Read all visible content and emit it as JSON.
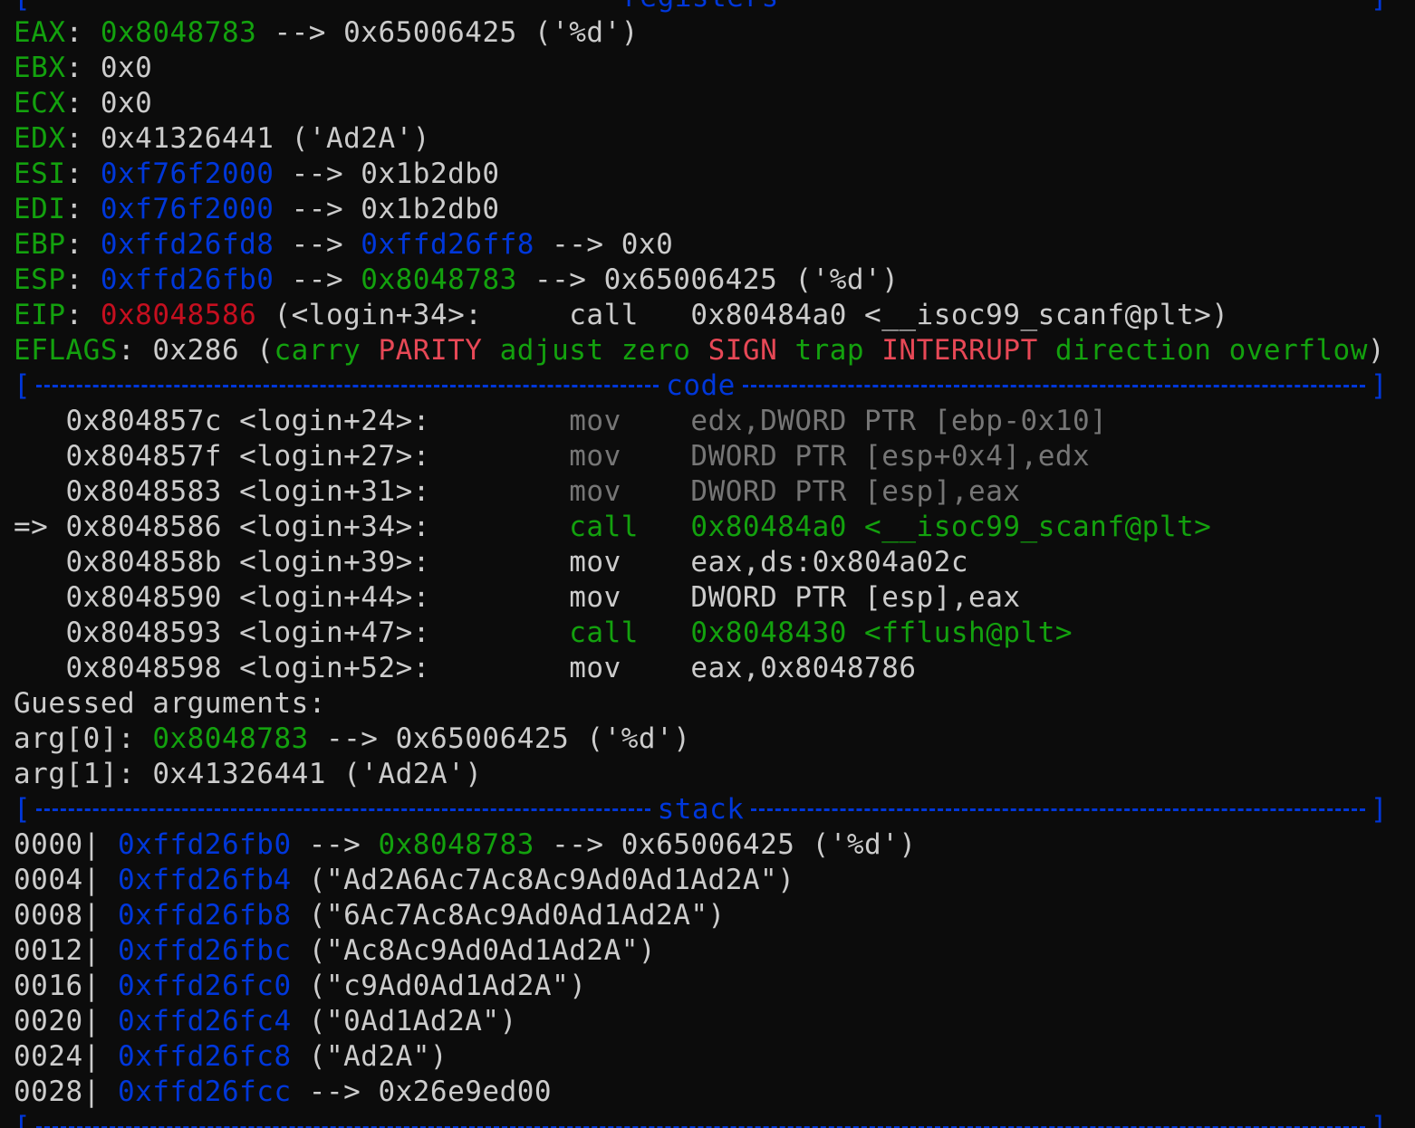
{
  "sections": {
    "registers": "registers",
    "code": "code",
    "stack": "stack"
  },
  "registers": [
    {
      "name": "EAX",
      "parts": [
        {
          "t": "0x8048783",
          "c": "green"
        },
        {
          "t": " --> 0x65006425 ('%d')",
          "c": "w"
        }
      ]
    },
    {
      "name": "EBX",
      "parts": [
        {
          "t": "0x0",
          "c": "w"
        }
      ]
    },
    {
      "name": "ECX",
      "parts": [
        {
          "t": "0x0",
          "c": "w"
        }
      ]
    },
    {
      "name": "EDX",
      "parts": [
        {
          "t": "0x41326441 ('Ad2A')",
          "c": "w"
        }
      ]
    },
    {
      "name": "ESI",
      "parts": [
        {
          "t": "0xf76f2000",
          "c": "blue"
        },
        {
          "t": " --> 0x1b2db0",
          "c": "w"
        }
      ]
    },
    {
      "name": "EDI",
      "parts": [
        {
          "t": "0xf76f2000",
          "c": "blue"
        },
        {
          "t": " --> 0x1b2db0",
          "c": "w"
        }
      ]
    },
    {
      "name": "EBP",
      "parts": [
        {
          "t": "0xffd26fd8",
          "c": "blue"
        },
        {
          "t": " --> ",
          "c": "w"
        },
        {
          "t": "0xffd26ff8",
          "c": "blue"
        },
        {
          "t": " --> 0x0",
          "c": "w"
        }
      ]
    },
    {
      "name": "ESP",
      "parts": [
        {
          "t": "0xffd26fb0",
          "c": "blue"
        },
        {
          "t": " --> ",
          "c": "w"
        },
        {
          "t": "0x8048783",
          "c": "green"
        },
        {
          "t": " --> 0x65006425 ('%d')",
          "c": "w"
        }
      ]
    },
    {
      "name": "EIP",
      "parts": [
        {
          "t": "0x8048586",
          "c": "red"
        },
        {
          "t": " (<login+34>:     call   0x80484a0 <__isoc99_scanf@plt>)",
          "c": "w"
        }
      ]
    },
    {
      "name": "EFLAGS",
      "parts": [
        {
          "t": "0x286 (",
          "c": "w"
        },
        {
          "t": "carry",
          "c": "green"
        },
        {
          "t": " ",
          "c": "w"
        },
        {
          "t": "PARITY",
          "c": "lred"
        },
        {
          "t": " ",
          "c": "w"
        },
        {
          "t": "adjust",
          "c": "green"
        },
        {
          "t": " ",
          "c": "w"
        },
        {
          "t": "zero",
          "c": "green"
        },
        {
          "t": " ",
          "c": "w"
        },
        {
          "t": "SIGN",
          "c": "lred"
        },
        {
          "t": " ",
          "c": "w"
        },
        {
          "t": "trap",
          "c": "green"
        },
        {
          "t": " ",
          "c": "w"
        },
        {
          "t": "INTERRUPT",
          "c": "lred"
        },
        {
          "t": " ",
          "c": "w"
        },
        {
          "t": "direction",
          "c": "green"
        },
        {
          "t": " ",
          "c": "w"
        },
        {
          "t": "overflow",
          "c": "green"
        },
        {
          "t": ")",
          "c": "w"
        }
      ]
    }
  ],
  "code": [
    {
      "prefix": "   ",
      "addr": "0x804857c",
      "sym": "<login+24>:",
      "op": "mov",
      "args": "edx,DWORD PTR [ebp-0x10]",
      "style": "past"
    },
    {
      "prefix": "   ",
      "addr": "0x804857f",
      "sym": "<login+27>:",
      "op": "mov",
      "args": "DWORD PTR [esp+0x4],edx",
      "style": "past"
    },
    {
      "prefix": "   ",
      "addr": "0x8048583",
      "sym": "<login+31>:",
      "op": "mov",
      "args": "DWORD PTR [esp],eax",
      "style": "past"
    },
    {
      "prefix": "=> ",
      "addr": "0x8048586",
      "sym": "<login+34>:",
      "op": "call",
      "args": "0x80484a0 <__isoc99_scanf@plt>",
      "style": "current"
    },
    {
      "prefix": "   ",
      "addr": "0x804858b",
      "sym": "<login+39>:",
      "op": "mov",
      "args": "eax,ds:0x804a02c",
      "style": "normal"
    },
    {
      "prefix": "   ",
      "addr": "0x8048590",
      "sym": "<login+44>:",
      "op": "mov",
      "args": "DWORD PTR [esp],eax",
      "style": "normal"
    },
    {
      "prefix": "   ",
      "addr": "0x8048593",
      "sym": "<login+47>:",
      "op": "call",
      "args": "0x8048430 <fflush@plt>",
      "style": "call"
    },
    {
      "prefix": "   ",
      "addr": "0x8048598",
      "sym": "<login+52>:",
      "op": "mov",
      "args": "eax,0x8048786",
      "style": "normal"
    }
  ],
  "guessed": {
    "heading": "Guessed arguments:",
    "args": [
      {
        "label": "arg[0]",
        "parts": [
          {
            "t": "0x8048783",
            "c": "green"
          },
          {
            "t": " --> 0x65006425 ('%d')",
            "c": "w"
          }
        ]
      },
      {
        "label": "arg[1]",
        "parts": [
          {
            "t": "0x41326441 ('Ad2A')",
            "c": "w"
          }
        ]
      }
    ]
  },
  "stack": [
    {
      "off": "0000",
      "addr": "0xffd26fb0",
      "parts": [
        {
          "t": " --> ",
          "c": "w"
        },
        {
          "t": "0x8048783",
          "c": "green"
        },
        {
          "t": " --> 0x65006425 ('%d')",
          "c": "w"
        }
      ]
    },
    {
      "off": "0004",
      "addr": "0xffd26fb4",
      "parts": [
        {
          "t": " (\"Ad2A6Ac7Ac8Ac9Ad0Ad1Ad2A\")",
          "c": "w"
        }
      ]
    },
    {
      "off": "0008",
      "addr": "0xffd26fb8",
      "parts": [
        {
          "t": " (\"6Ac7Ac8Ac9Ad0Ad1Ad2A\")",
          "c": "w"
        }
      ]
    },
    {
      "off": "0012",
      "addr": "0xffd26fbc",
      "parts": [
        {
          "t": " (\"Ac8Ac9Ad0Ad1Ad2A\")",
          "c": "w"
        }
      ]
    },
    {
      "off": "0016",
      "addr": "0xffd26fc0",
      "parts": [
        {
          "t": " (\"c9Ad0Ad1Ad2A\")",
          "c": "w"
        }
      ]
    },
    {
      "off": "0020",
      "addr": "0xffd26fc4",
      "parts": [
        {
          "t": " (\"0Ad1Ad2A\")",
          "c": "w"
        }
      ]
    },
    {
      "off": "0024",
      "addr": "0xffd26fc8",
      "parts": [
        {
          "t": " (\"Ad2A\")",
          "c": "w"
        }
      ]
    },
    {
      "off": "0028",
      "addr": "0xffd26fcc",
      "parts": [
        {
          "t": " --> 0x26e9ed00",
          "c": "w"
        }
      ]
    }
  ],
  "colors": {
    "background": "#0c0c0c",
    "text": "#cccccc",
    "green": "#13a10e",
    "blue": "#0037da",
    "red": "#c50f1f",
    "light_red": "#e74856",
    "dim": "#767676"
  }
}
